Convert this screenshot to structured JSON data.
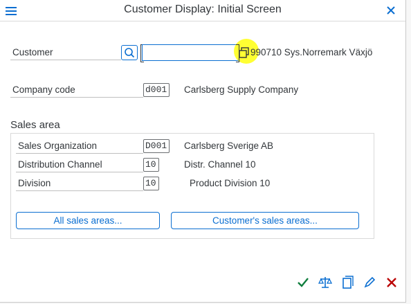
{
  "window": {
    "title": "Customer Display: Initial Screen"
  },
  "customer": {
    "label": "Customer",
    "value": "",
    "description": "990710 Sys.Norremark Växjö"
  },
  "company_code": {
    "label": "Company code",
    "value": "d001",
    "description": "Carlsberg Supply Company"
  },
  "sales_area": {
    "title": "Sales area",
    "sales_org": {
      "label": "Sales Organization",
      "value": "D001",
      "description": "Carlsberg Sverige AB"
    },
    "distribution_channel": {
      "label": "Distribution Channel",
      "value": "10",
      "description": "Distr. Channel 10"
    },
    "division": {
      "label": "Division",
      "value": "10",
      "description": "Product Division 10"
    },
    "all_sales_areas_label": "All sales areas...",
    "customers_sales_areas_label": "Customer's sales areas..."
  },
  "colors": {
    "accent": "#0a6ed1",
    "confirm": "#107e3e",
    "cancel": "#bb0000",
    "highlight": "#ffff33"
  },
  "footer": {
    "icons": [
      "checkmark-icon",
      "balance-scale-icon",
      "copy-icon",
      "edit-pencil-icon",
      "cancel-x-icon"
    ]
  }
}
